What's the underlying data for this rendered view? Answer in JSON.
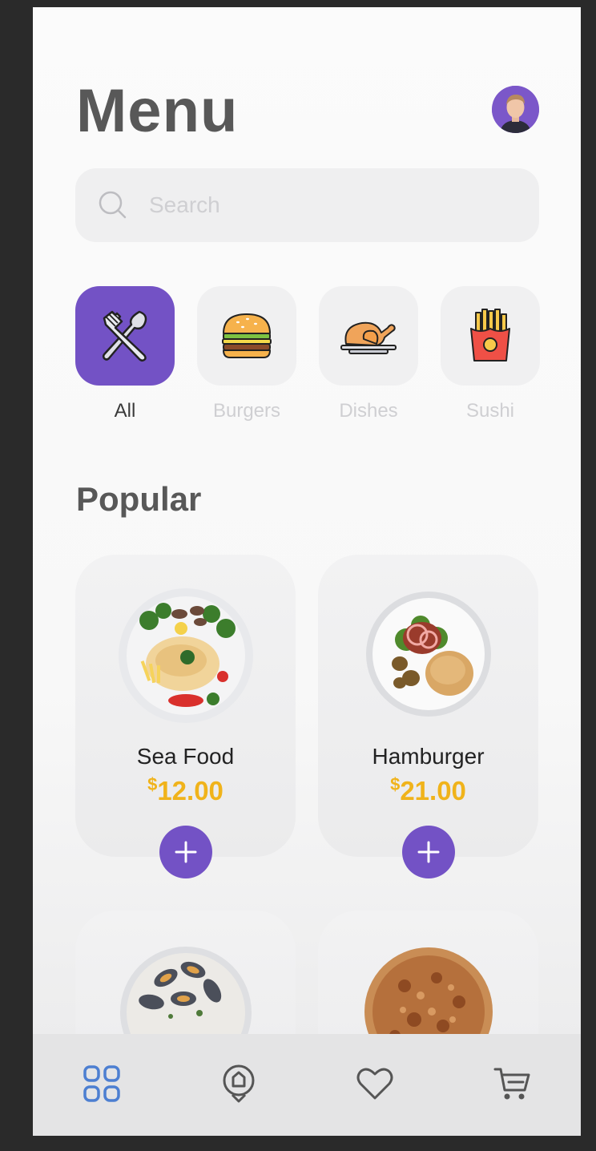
{
  "header": {
    "title": "Menu"
  },
  "search": {
    "placeholder": "Search"
  },
  "categories": [
    {
      "label": "All",
      "active": true
    },
    {
      "label": "Burgers",
      "active": false
    },
    {
      "label": "Dishes",
      "active": false
    },
    {
      "label": "Sushi",
      "active": false
    }
  ],
  "popular": {
    "title": "Popular",
    "items": [
      {
        "name": "Sea Food",
        "currency": "$",
        "price": "12.00"
      },
      {
        "name": "Hamburger",
        "currency": "$",
        "price": "21.00"
      }
    ]
  },
  "colors": {
    "accent": "#7352c5",
    "price": "#f0b31b",
    "nav_active": "#4d7fd1"
  },
  "nav": {
    "items": [
      "home-grid-icon",
      "location-pin-icon",
      "heart-icon",
      "cart-icon"
    ]
  }
}
